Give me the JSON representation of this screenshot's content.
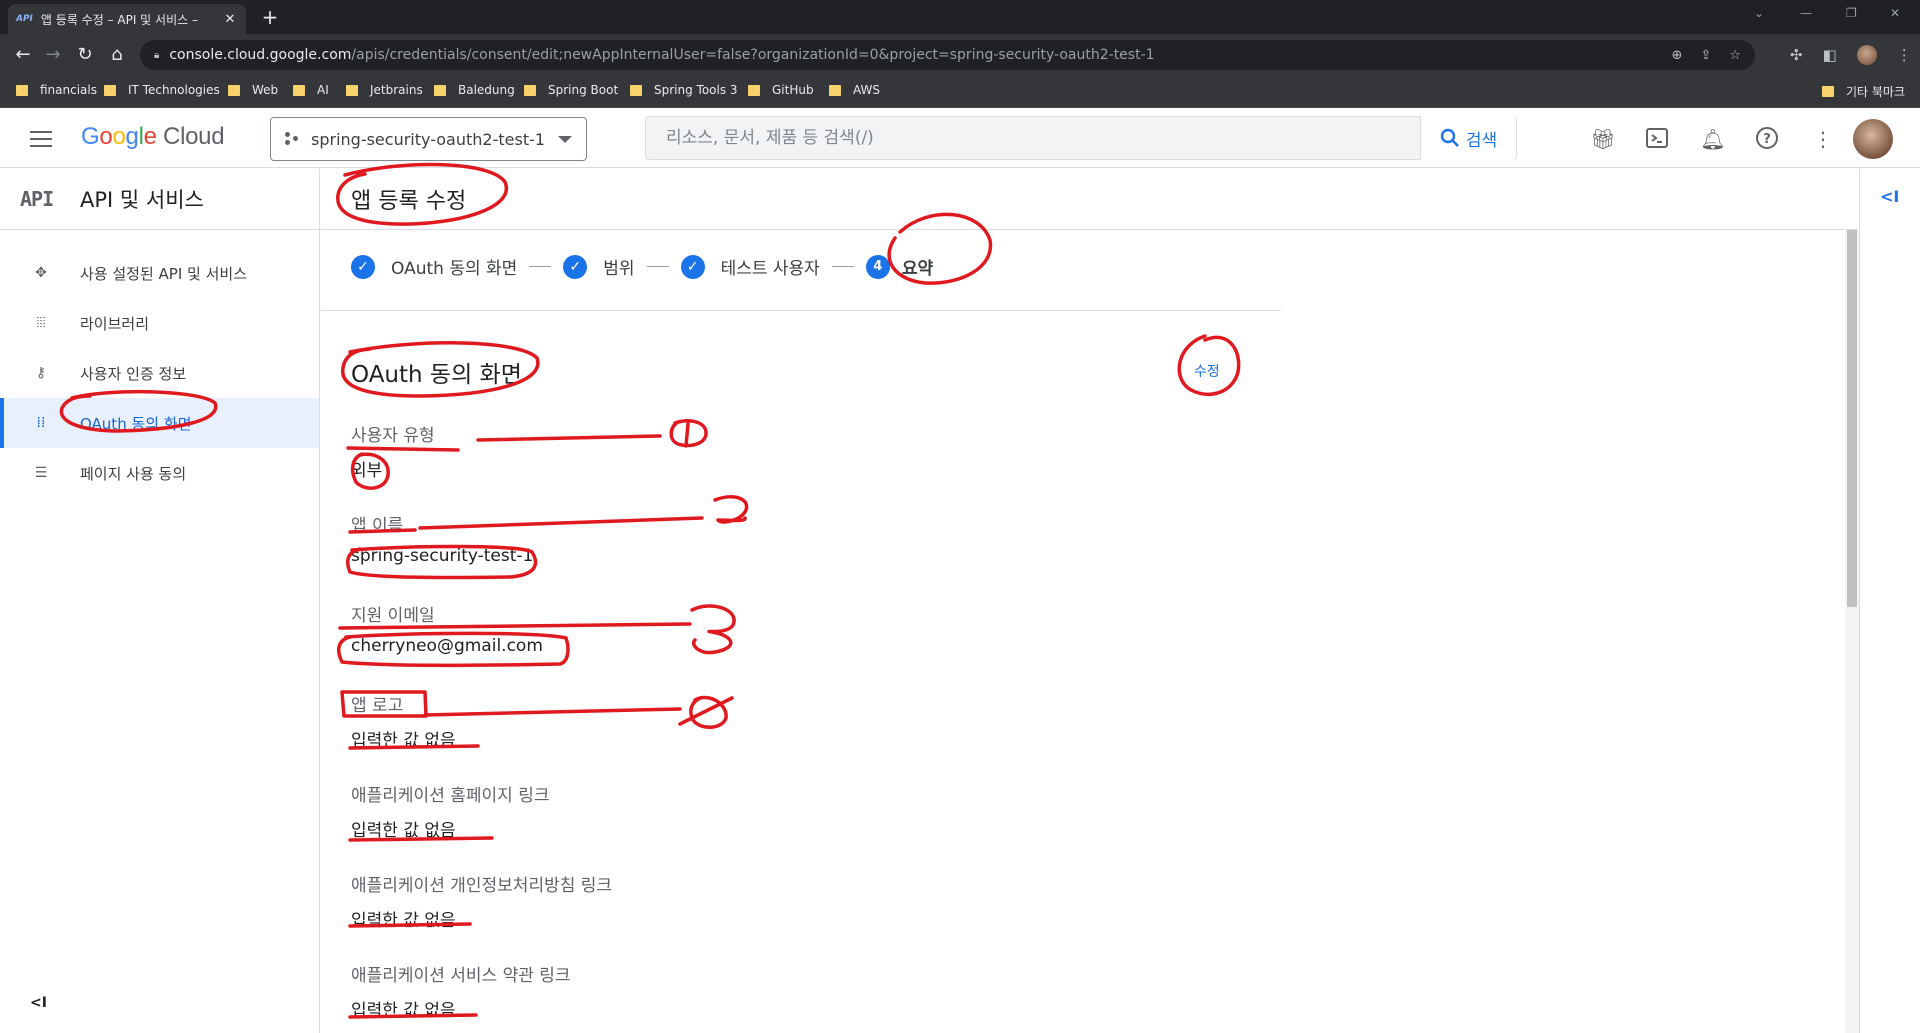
{
  "browser": {
    "tab_favicon": "API",
    "tab_title": "앱 등록 수정 – API 및 서비스 – ",
    "tab_close": "✕",
    "new_tab": "+",
    "url_host": "console.cloud.google.com",
    "url_path": "/apis/credentials/consent/edit;newAppInternalUser=false?organizationId=0&project=spring-security-oauth2-test-1",
    "bookmarks": [
      "financials",
      "IT Technologies",
      "Web",
      "AI",
      "Jetbrains",
      "Baledung",
      "Spring Boot",
      "Spring Tools 3",
      "GitHub",
      "AWS"
    ],
    "other_bookmarks": "기타 북마크"
  },
  "header": {
    "logo_google": [
      "G",
      "o",
      "o",
      "g",
      "l",
      "e"
    ],
    "logo_cloud": "Cloud",
    "project": "spring-security-oauth2-test-1",
    "search_placeholder": "리소스, 문서, 제품 등 검색(/)",
    "search_button": "검색"
  },
  "sidebar": {
    "api_badge": "API",
    "title": "API 및 서비스",
    "items": [
      {
        "label": "사용 설정된 API 및 서비스",
        "icon": "api-hub-icon"
      },
      {
        "label": "라이브러리",
        "icon": "library-icon"
      },
      {
        "label": "사용자 인증 정보",
        "icon": "key-icon"
      },
      {
        "label": "OAuth 동의 화면",
        "icon": "consent-grid-icon",
        "active": true
      },
      {
        "label": "페이지 사용 동의",
        "icon": "settings-list-icon"
      }
    ],
    "collapse": "<I"
  },
  "main": {
    "page_title": "앱 등록 수정",
    "steps": [
      {
        "label": "OAuth 동의 화면",
        "state": "done"
      },
      {
        "label": "범위",
        "state": "done"
      },
      {
        "label": "테스트 사용자",
        "state": "done"
      },
      {
        "label": "요약",
        "state": "current",
        "number": "4"
      }
    ],
    "section_title": "OAuth 동의 화면",
    "edit_label": "수정",
    "fields": [
      {
        "label": "사용자 유형",
        "value": "외부"
      },
      {
        "label": "앱 이름",
        "value": "spring-security-test-1"
      },
      {
        "label": "지원 이메일",
        "value": "cherryneo@gmail.com"
      },
      {
        "label": "앱 로고",
        "value": "입력한 값 없음"
      },
      {
        "label": "애플리케이션 홈페이지 링크",
        "value": "입력한 값 없음"
      },
      {
        "label": "애플리케이션 개인정보처리방침 링크",
        "value": "입력한 값 없음"
      },
      {
        "label": "애플리케이션 서비스 약관 링크",
        "value": "입력한 값 없음"
      }
    ]
  },
  "right_panel": {
    "collapse": "<I"
  },
  "colors": {
    "accent": "#1a73e8",
    "annotation": "#e0191f",
    "active_bg": "#e8f0fe"
  }
}
